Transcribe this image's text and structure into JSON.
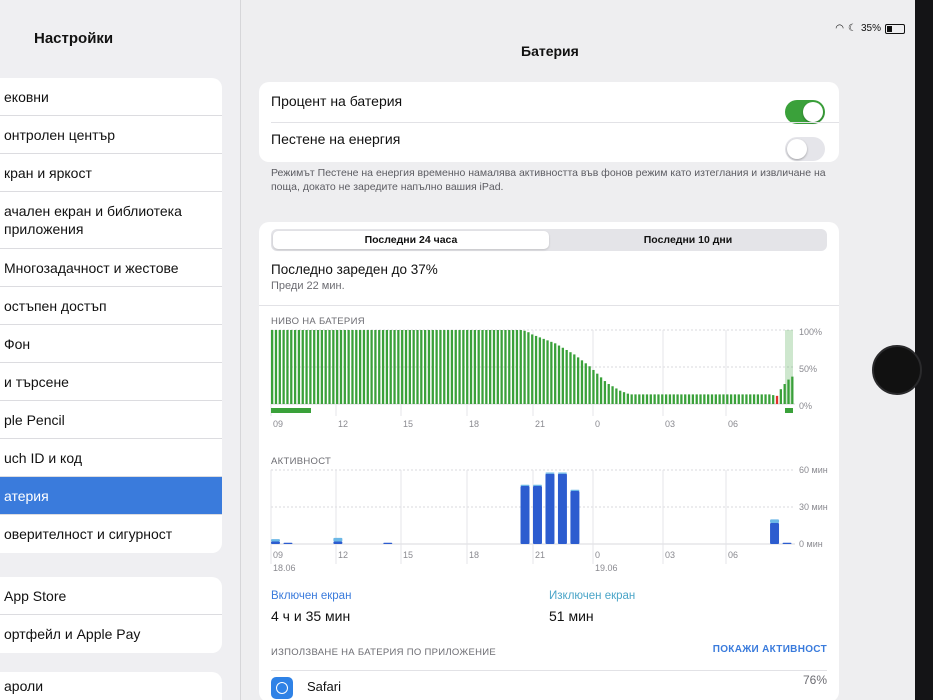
{
  "status_bar": {
    "battery_pct": "35%"
  },
  "sidebar": {
    "title": "Настройки",
    "groups": [
      [
        "ековни",
        "онтролен център",
        "кран и яркост",
        "ачален екран и библиотека\nприложения",
        "Многозадачност и жестове",
        "остъпен достъп",
        "Фон",
        "и търсене",
        "ple Pencil",
        "uch ID и код",
        "атерия",
        "оверителност и сигурност"
      ],
      [
        "App Store",
        "ортфейл и Apple Pay"
      ],
      [
        "ароли"
      ]
    ],
    "selected": "атерия"
  },
  "page_title": "Батерия",
  "toggles": {
    "battery_pct_label": "Процент на батерия",
    "battery_pct_on": true,
    "low_power_label": "Пестене на енергия",
    "low_power_on": false
  },
  "note": "Режимът Пестене на енергия временно намалява активността във фонов режим като изтеглания и извличане на поща, докато не заредите напълно вашия iPad.",
  "segment": {
    "active": "Последни 24 часа",
    "inactive": "Последни 10 дни"
  },
  "last_charged": "Последно зареден до 37%",
  "ago": "Преди 22 мин.",
  "battery_level_label": "НИВО НА БАТЕРИЯ",
  "activity_label": "АКТИВНОСТ",
  "screen_on_label": "Включен екран",
  "screen_on_value": "4 ч и 35 мин",
  "screen_off_label": "Изключен екран",
  "screen_off_value": "51 мин",
  "app_usage_header": "ИЗПОЛЗВАНЕ НА БАТЕРИЯ ПО ПРИЛОЖЕНИЕ",
  "show_activity": "ПОКАЖИ АКТИВНОСТ",
  "app": {
    "name": "Safari",
    "pct": "76%"
  },
  "colors": {
    "green": "#3aa13a",
    "blue": "#2c5ccf",
    "lightblue": "#6cb8e6",
    "accent": "#3a7bdc",
    "red": "#e0312b"
  },
  "chart_data": [
    {
      "type": "bar",
      "title": "НИВО НА БАТЕРИЯ",
      "x_ticks": [
        "09",
        "12",
        "15",
        "18",
        "21",
        "0",
        "03",
        "06"
      ],
      "y_ticks": [
        "100%",
        "50%",
        "0%"
      ],
      "ylim": [
        0,
        100
      ],
      "values": [
        100,
        100,
        100,
        100,
        100,
        100,
        100,
        100,
        100,
        100,
        100,
        100,
        100,
        100,
        100,
        100,
        100,
        100,
        100,
        100,
        100,
        100,
        100,
        100,
        100,
        100,
        100,
        100,
        100,
        100,
        100,
        100,
        100,
        100,
        100,
        100,
        100,
        100,
        100,
        100,
        100,
        100,
        100,
        100,
        100,
        100,
        100,
        100,
        100,
        100,
        100,
        100,
        100,
        100,
        100,
        100,
        100,
        100,
        100,
        100,
        100,
        100,
        100,
        100,
        100,
        100,
        99,
        97,
        94,
        92,
        90,
        88,
        86,
        84,
        82,
        79,
        76,
        73,
        70,
        67,
        63,
        59,
        55,
        51,
        46,
        41,
        36,
        31,
        27,
        24,
        21,
        18,
        16,
        14,
        13,
        13,
        13,
        13,
        13,
        13,
        13,
        13,
        13,
        13,
        13,
        13,
        13,
        13,
        13,
        13,
        13,
        13,
        13,
        13,
        13,
        13,
        13,
        13,
        13,
        13,
        13,
        13,
        13,
        13,
        13,
        13,
        13,
        13,
        13,
        13,
        13,
        12,
        11,
        20,
        27,
        33,
        37
      ]
    },
    {
      "type": "bar",
      "title": "АКТИВНОСТ",
      "x_ticks": [
        "09",
        "12",
        "15",
        "18",
        "21",
        "0",
        "03",
        "06"
      ],
      "x_dates": [
        "18.06",
        "19.06"
      ],
      "y_ticks": [
        "60 мин",
        "30 мин",
        "0 мин"
      ],
      "ylim": [
        0,
        60
      ],
      "series": [
        {
          "name": "Включен екран",
          "values": [
            2,
            1,
            0,
            0,
            0,
            2,
            0,
            0,
            0,
            1,
            0,
            0,
            0,
            0,
            0,
            0,
            0,
            0,
            0,
            0,
            47,
            47,
            57,
            57,
            43,
            0,
            0,
            0,
            0,
            0,
            0,
            0,
            0,
            0,
            0,
            0,
            0,
            0,
            0,
            0,
            17,
            1
          ]
        },
        {
          "name": "Изключен екран",
          "values": [
            2,
            0,
            0,
            0,
            0,
            3,
            0,
            0,
            0,
            0,
            0,
            0,
            0,
            0,
            0,
            0,
            0,
            0,
            0,
            0,
            1,
            1,
            1,
            1,
            1,
            0,
            0,
            0,
            0,
            0,
            0,
            0,
            0,
            0,
            0,
            0,
            0,
            0,
            0,
            0,
            3,
            0
          ]
        }
      ]
    }
  ]
}
